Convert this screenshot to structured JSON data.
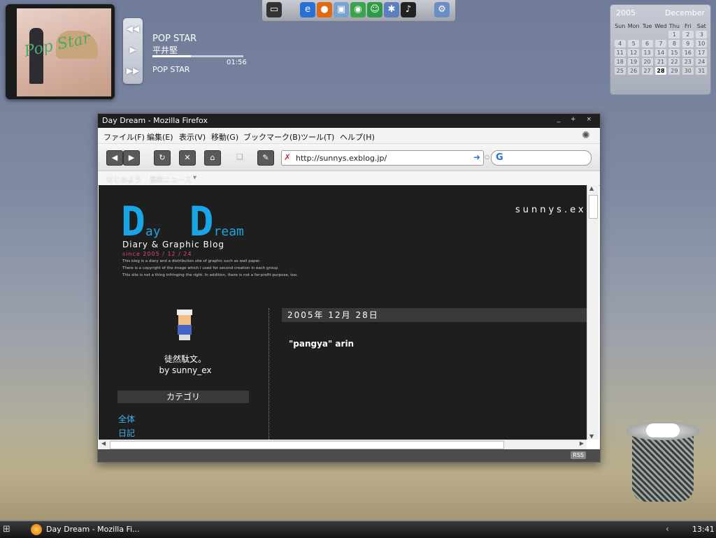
{
  "music": {
    "title": "POP STAR",
    "artist": "平井堅",
    "album": "POP STAR",
    "elapsed": "01:56",
    "progress": 0.42,
    "controls": [
      "previous-icon",
      "play-icon",
      "next-icon"
    ]
  },
  "dock": {
    "icons": [
      "monitor-icon",
      "internet-explorer-icon",
      "firefox-icon",
      "network-icon",
      "media-player-icon",
      "messenger-icon",
      "settings-icon",
      "music-player-icon",
      "control-panel-icon"
    ]
  },
  "calendar": {
    "year": "2005",
    "month": "December",
    "weekdays": [
      "Sun",
      "Mon",
      "Tue",
      "Wed",
      "Thu",
      "Fri",
      "Sat"
    ],
    "weeks": [
      [
        "",
        "",
        "",
        "",
        "1",
        "2",
        "3"
      ],
      [
        "4",
        "5",
        "6",
        "7",
        "8",
        "9",
        "10"
      ],
      [
        "11",
        "12",
        "13",
        "14",
        "15",
        "16",
        "17"
      ],
      [
        "18",
        "19",
        "20",
        "21",
        "22",
        "23",
        "24"
      ],
      [
        "25",
        "26",
        "27",
        "28",
        "29",
        "30",
        "31"
      ]
    ],
    "today": "28"
  },
  "browser": {
    "title": "Day Dream - Mozilla Firefox",
    "window_buttons": "_ + ×",
    "menu": [
      "ファイル(F)",
      "編集(E)",
      "表示(V)",
      "移動(G)",
      "ブックマーク(B)",
      "ツール(T)",
      "ヘルプ(H)"
    ],
    "url": "http://sunnys.exblog.jp/",
    "search_placeholder": "",
    "bookmarks": [
      "はじめよう",
      "最新ニュース"
    ],
    "rss": "RSS"
  },
  "blog": {
    "logo_d1": "D",
    "logo_ay": "ay",
    "logo_d2": "D",
    "logo_ream": "ream",
    "subtitle": "Diary & Graphic Blog",
    "since": "since 2005 / 12 / 24",
    "desc1": "This blog is a diary and a distribution site of graphic such as wall paper.",
    "desc2": "There is a copyright of the image which I used for second creation in each group.",
    "desc3": "This site is not a thing infringing the right. In addition, there is not a for-profit purpose, too.",
    "header_right": "sunnys.ex",
    "aphorism": "徒然駄文。",
    "author": "by sunny_ex",
    "category_heading": "カテゴリ",
    "categories": [
      "全体",
      "日記"
    ],
    "date": "2005年 12月 28日",
    "post_title": "\"pangya\" arin"
  },
  "taskbar": {
    "task": "Day Dream - Mozilla Fi...",
    "clock": "13:41"
  }
}
